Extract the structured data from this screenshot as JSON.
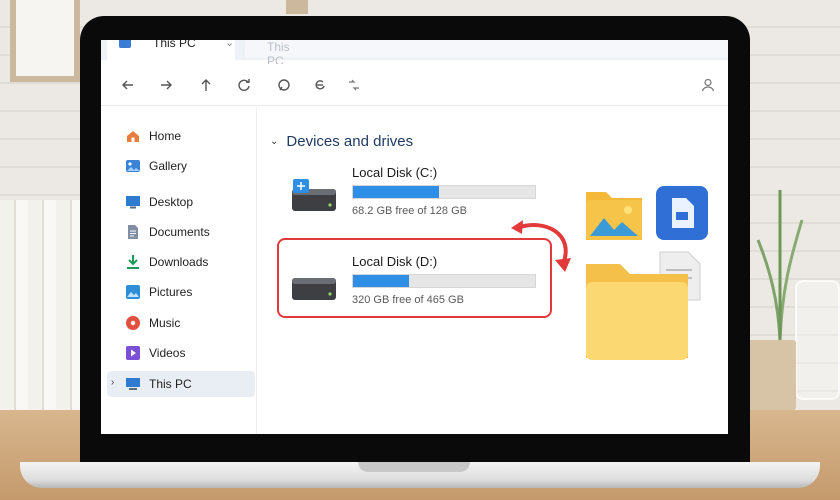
{
  "window": {
    "tab_title": "This PC",
    "ghost_tab_title": "This PC"
  },
  "toolbar": {
    "buttons": [
      "back-arrow-icon",
      "forward-arrow-icon",
      "up-arrow-icon",
      "refresh-icon",
      "cut-icon",
      "copy-icon",
      "share-icon",
      "account-icon"
    ]
  },
  "sidebar": {
    "items": [
      {
        "label": "Home",
        "icon": "home-icon"
      },
      {
        "label": "Gallery",
        "icon": "gallery-icon"
      },
      {
        "label": "Desktop",
        "icon": "desktop-icon"
      },
      {
        "label": "Documents",
        "icon": "documents-icon"
      },
      {
        "label": "Downloads",
        "icon": "downloads-icon"
      },
      {
        "label": "Pictures",
        "icon": "pictures-icon"
      },
      {
        "label": "Music",
        "icon": "music-icon"
      },
      {
        "label": "Videos",
        "icon": "videos-icon"
      },
      {
        "label": "This PC",
        "icon": "this-pc-icon",
        "selected": true
      }
    ]
  },
  "main": {
    "section_title": "Devices and drives",
    "drives": [
      {
        "name": "Local Disk (C:)",
        "free_text": "68.2 GB free of 128 GB",
        "used_fraction": 0.47
      },
      {
        "name": "Local Disk (D:)",
        "free_text": "320 GB free of 465 GB",
        "used_fraction": 0.31
      }
    ]
  },
  "colors": {
    "accent": "#2f8ee6",
    "highlight": "#e23a3a",
    "folder": "#f7c44a"
  }
}
